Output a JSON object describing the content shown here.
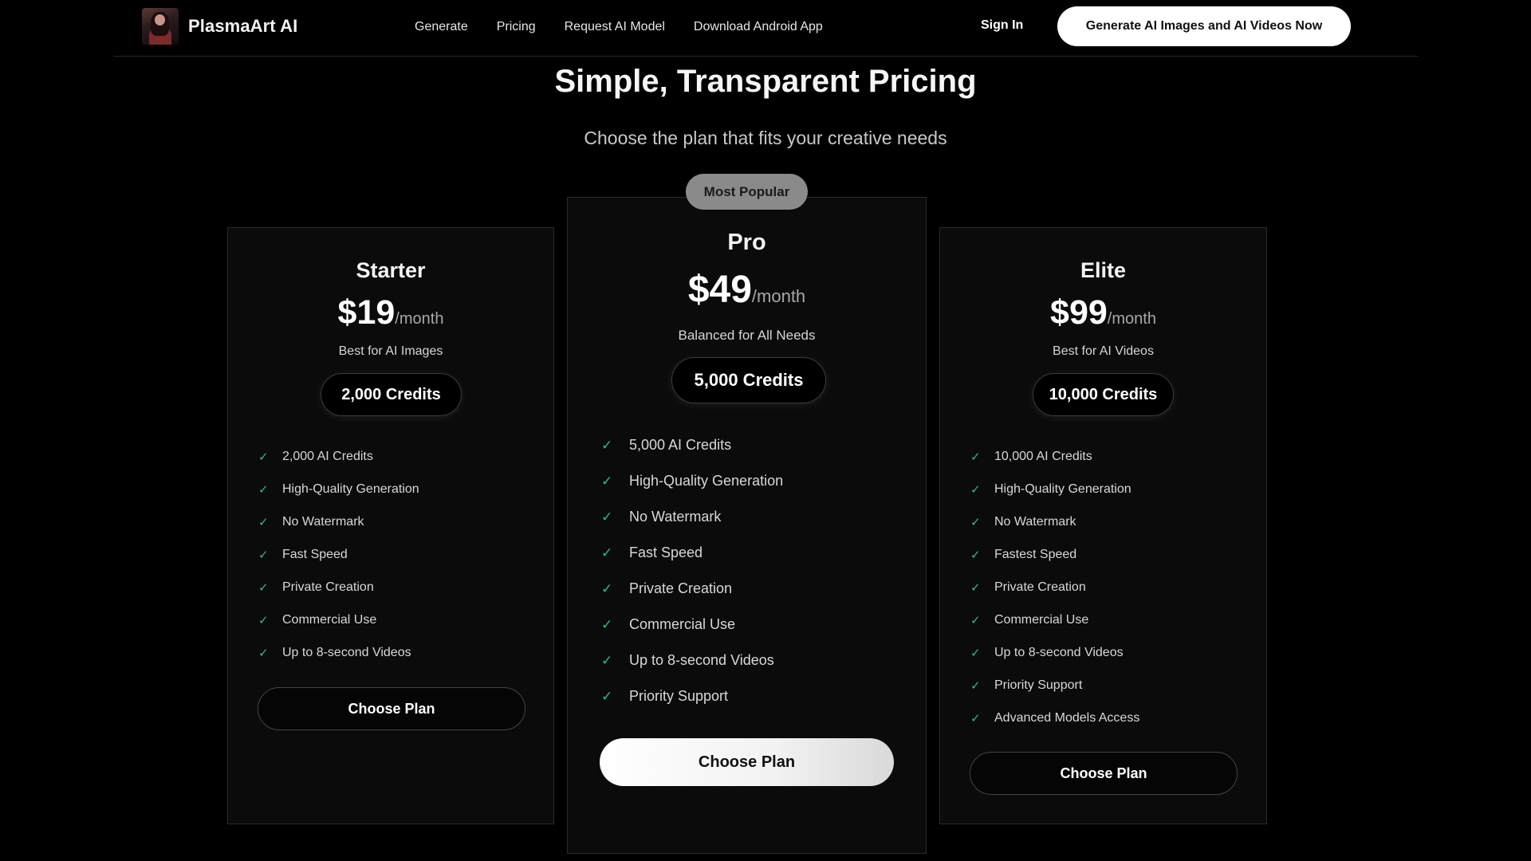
{
  "header": {
    "brand_name": "PlasmaArt AI",
    "nav": [
      "Generate",
      "Pricing",
      "Request AI Model",
      "Download Android App"
    ],
    "sign_in": "Sign In",
    "cta": "Generate AI Images and AI Videos Now"
  },
  "hero": {
    "title": "Simple, Transparent Pricing",
    "subtitle": "Choose the plan that fits your creative needs"
  },
  "plans": [
    {
      "name": "Starter",
      "price": "$19",
      "period": "/month",
      "tagline": "Best for AI Images",
      "credits": "2,000 Credits",
      "features": [
        "2,000 AI Credits",
        "High-Quality Generation",
        "No Watermark",
        "Fast Speed",
        "Private Creation",
        "Commercial Use",
        "Up to 8-second Videos"
      ],
      "button": "Choose Plan"
    },
    {
      "badge": "Most Popular",
      "name": "Pro",
      "price": "$49",
      "period": "/month",
      "tagline": "Balanced for All Needs",
      "credits": "5,000 Credits",
      "features": [
        "5,000 AI Credits",
        "High-Quality Generation",
        "No Watermark",
        "Fast Speed",
        "Private Creation",
        "Commercial Use",
        "Up to 8-second Videos",
        "Priority Support"
      ],
      "button": "Choose Plan"
    },
    {
      "name": "Elite",
      "price": "$99",
      "period": "/month",
      "tagline": "Best for AI Videos",
      "credits": "10,000 Credits",
      "features": [
        "10,000 AI Credits",
        "High-Quality Generation",
        "No Watermark",
        "Fastest Speed",
        "Private Creation",
        "Commercial Use",
        "Up to 8-second Videos",
        "Priority Support",
        "Advanced Models Access"
      ],
      "button": "Choose Plan"
    }
  ],
  "colors": {
    "background": "#000000",
    "check": "#2fbf71",
    "badge": "#8a8a8a"
  },
  "icons": {
    "feature_bullet": "check-icon"
  }
}
